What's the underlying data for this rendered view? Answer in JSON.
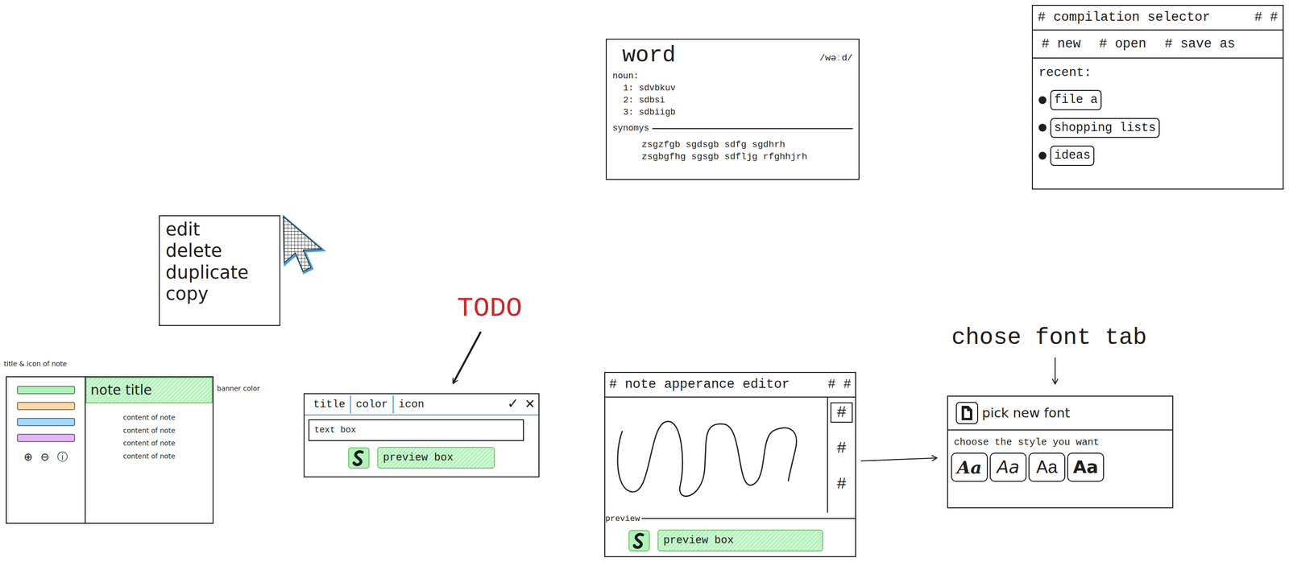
{
  "context_menu": {
    "items": [
      "edit",
      "delete",
      "duplicate",
      "copy"
    ]
  },
  "dictionary": {
    "word": "word",
    "pronunciation": "/wəːd/",
    "part_of_speech": "noun:",
    "definitions": [
      "1: sdvbkuv",
      "2: sdbsi",
      "3: sdbiigb"
    ],
    "synonyms_label": "synomys",
    "synonyms": [
      "zsgzfgb sgdsgb sdfg sgdhrh",
      "zsgbgfhg sgsgb sdfljg rfghhjrh"
    ]
  },
  "compilation_selector": {
    "title": "# compilation selector",
    "controls": "# #",
    "menu": [
      "# new",
      "# open",
      "# save as"
    ],
    "recent_label": "recent:",
    "recent": [
      "file a",
      "shopping lists",
      "ideas"
    ]
  },
  "note_layout": {
    "caption": "title & icon of note",
    "banner_caption": "banner color",
    "notes": [
      {
        "color": "#b2f2bb"
      },
      {
        "color": "#ffd8a8"
      },
      {
        "color": "#a5d8ff"
      },
      {
        "color": "#e5b8f5"
      }
    ],
    "buttons": [
      "⊕",
      "⊖",
      "ⓘ"
    ],
    "title": "note title",
    "content": [
      "content of note",
      "content of note",
      "content of note",
      "content of note"
    ]
  },
  "todo": {
    "label": "TODO"
  },
  "title_editor": {
    "tabs": [
      "title",
      "color",
      "icon"
    ],
    "confirm": "✓",
    "cancel": "✕",
    "field_value": "text box",
    "preview": "preview box"
  },
  "appearance_editor": {
    "title": "# note apperance editor",
    "controls": "# #",
    "tools": [
      {
        "label": "#",
        "selected": true
      },
      {
        "label": "#",
        "selected": false
      },
      {
        "label": "#",
        "selected": false
      }
    ],
    "preview_label": "preview",
    "preview": "preview box"
  },
  "font_tab": {
    "caption": "chose font tab",
    "title": "pick new font",
    "prompt": "choose the style you want",
    "styles": [
      "Aa",
      "Aa",
      "Aa",
      "Aa"
    ]
  }
}
